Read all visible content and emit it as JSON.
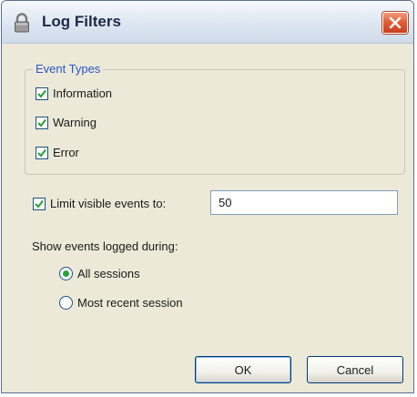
{
  "window": {
    "title": "Log Filters",
    "colors": {
      "title_text": "#1b2a4a",
      "close_button": "#e05a34",
      "group_legend": "#2a56c6",
      "check_mark": "#2aa43a"
    }
  },
  "event_types": {
    "legend": "Event Types",
    "items": [
      {
        "label": "Information",
        "checked": true
      },
      {
        "label": "Warning",
        "checked": true
      },
      {
        "label": "Error",
        "checked": true
      }
    ]
  },
  "limit": {
    "label": "Limit visible events to:",
    "checked": true,
    "value": "50"
  },
  "sessions": {
    "label": "Show events logged during:",
    "options": [
      {
        "label": "All sessions",
        "selected": true
      },
      {
        "label": "Most recent session",
        "selected": false
      }
    ]
  },
  "buttons": {
    "ok": "OK",
    "cancel": "Cancel"
  },
  "icons": {
    "title": "lock-icon",
    "close": "close-icon",
    "check": "checkmark-icon"
  }
}
